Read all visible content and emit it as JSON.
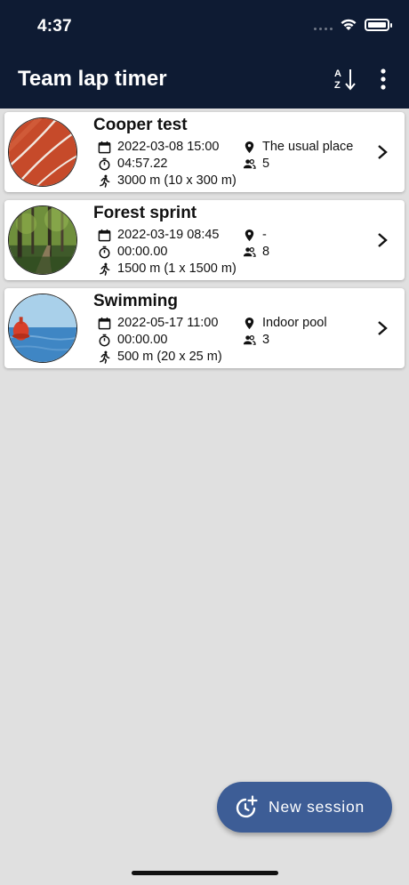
{
  "status_bar": {
    "time": "4:37"
  },
  "app_bar": {
    "title": "Team lap timer",
    "sort_icon": "sort-alpha-icon",
    "menu_icon": "more-vert-icon"
  },
  "sessions": [
    {
      "title": "Cooper test",
      "datetime": "2022-03-08 15:00",
      "location": "The usual place",
      "duration": "04:57.22",
      "participants": "5",
      "distance": "3000 m (10 x 300 m)",
      "image": "running-track"
    },
    {
      "title": "Forest sprint",
      "datetime": "2022-03-19 08:45",
      "location": "-",
      "duration": "00:00.00",
      "participants": "8",
      "distance": "1500 m (1 x 1500 m)",
      "image": "forest-path"
    },
    {
      "title": "Swimming",
      "datetime": "2022-05-17 11:00",
      "location": "Indoor pool",
      "duration": "00:00.00",
      "participants": "3",
      "distance": "500 m (20 x 25 m)",
      "image": "sea-buoy"
    }
  ],
  "fab": {
    "label": "New session",
    "icon": "add-timer-icon"
  },
  "colors": {
    "app_bar": "#0e1b33",
    "fab": "#3d5d96",
    "background": "#e0e0e0"
  }
}
